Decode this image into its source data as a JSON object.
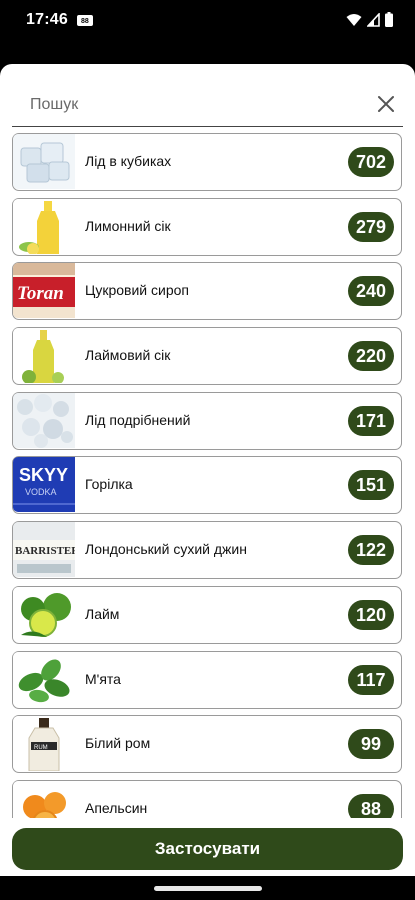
{
  "status_bar": {
    "time": "17:46",
    "badge": "88",
    "icons": [
      "wifi-icon",
      "signal-icon",
      "battery-icon"
    ]
  },
  "search": {
    "placeholder": "Пошук",
    "value": ""
  },
  "items": [
    {
      "label": "Лід в кубиках",
      "count": "702",
      "icon": "ice-cubes-thumbnail"
    },
    {
      "label": "Лимонний сік",
      "count": "279",
      "icon": "lemon-juice-thumbnail"
    },
    {
      "label": "Цукровий сироп",
      "count": "240",
      "icon": "sugar-syrup-thumbnail"
    },
    {
      "label": "Лаймовий сік",
      "count": "220",
      "icon": "lime-juice-thumbnail"
    },
    {
      "label": "Лід подрібнений",
      "count": "171",
      "icon": "crushed-ice-thumbnail"
    },
    {
      "label": "Горілка",
      "count": "151",
      "icon": "vodka-thumbnail"
    },
    {
      "label": "Лондонський сухий джин",
      "count": "122",
      "icon": "gin-thumbnail"
    },
    {
      "label": "Лайм",
      "count": "120",
      "icon": "lime-thumbnail"
    },
    {
      "label": "М'ята",
      "count": "117",
      "icon": "mint-thumbnail"
    },
    {
      "label": "Білий ром",
      "count": "99",
      "icon": "white-rum-thumbnail"
    },
    {
      "label": "Апельсин",
      "count": "88",
      "icon": "orange-thumbnail"
    }
  ],
  "thumb_text": {
    "torani": "Toran",
    "skyy": "SKYY",
    "vodka": "VODKA",
    "barrister": "BARRISTER",
    "rum": "RUM"
  },
  "apply_label": "Застосувати",
  "colors": {
    "accent": "#2f4a1a",
    "border": "#9a9a9a"
  }
}
